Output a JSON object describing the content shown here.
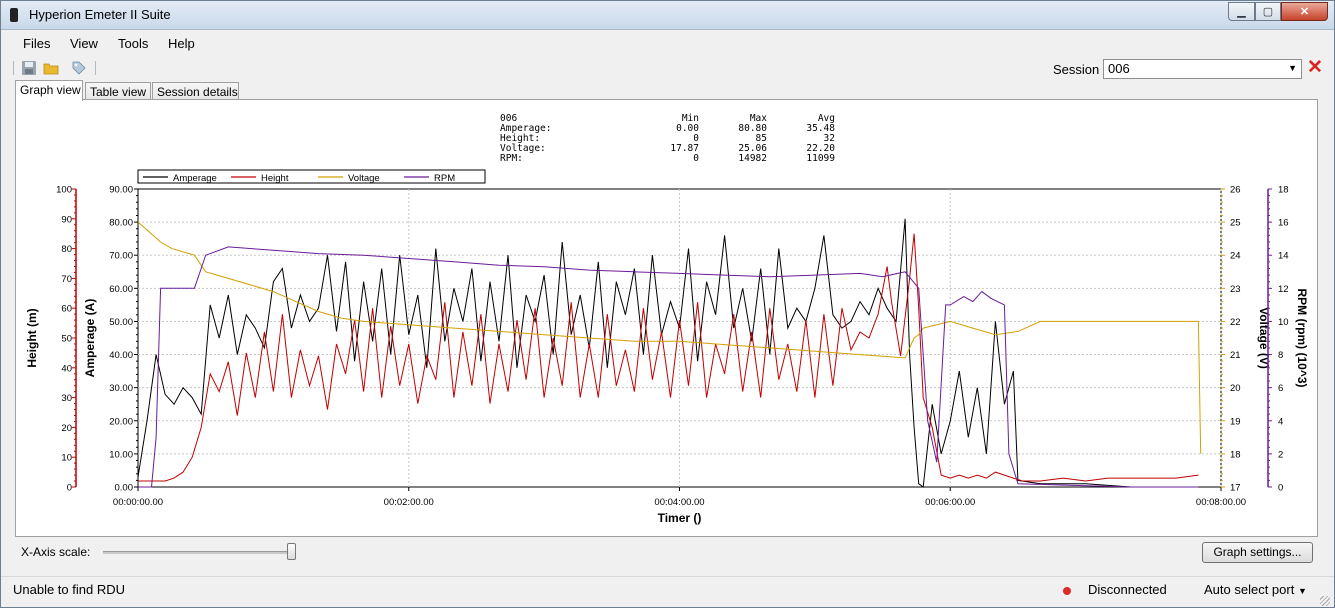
{
  "window": {
    "title": "Hyperion Emeter II Suite"
  },
  "menu": {
    "items": [
      "Files",
      "View",
      "Tools",
      "Help"
    ]
  },
  "toolbar": {
    "icons": [
      "save-icon",
      "open-folder-icon",
      "tag-icon"
    ],
    "session_label": "Session",
    "session_value": "006"
  },
  "tabs": [
    {
      "label": "Graph view",
      "active": true
    },
    {
      "label": "Table view"
    },
    {
      "label": "Session details"
    }
  ],
  "stats": {
    "session": "006",
    "headers": [
      "Min",
      "Max",
      "Avg"
    ],
    "rows": [
      {
        "name": "Amperage:",
        "min": "0.00",
        "max": "80.80",
        "avg": "35.48"
      },
      {
        "name": "Height:",
        "min": "0",
        "max": "85",
        "avg": "32"
      },
      {
        "name": "Voltage:",
        "min": "17.87",
        "max": "25.06",
        "avg": "22.20"
      },
      {
        "name": "RPM:",
        "min": "0",
        "max": "14982",
        "avg": "11099"
      }
    ]
  },
  "chart_data": {
    "type": "line",
    "xlabel": "Timer ()",
    "x_unit": "seconds",
    "xlim": [
      0,
      480
    ],
    "x_ticks": [
      "00:00:00.00",
      "00:02:00.00",
      "00:04:00.00",
      "00:06:00.00",
      "00:08:00.00"
    ],
    "legend": [
      "Amperage",
      "Height",
      "Voltage",
      "RPM"
    ],
    "legend_placement": "top-left",
    "grid": true,
    "axes": {
      "height": {
        "label": "Height (m)",
        "side": "left-outer",
        "range": [
          0,
          100
        ],
        "ticks": [
          "0",
          "10",
          "20",
          "30",
          "40",
          "50",
          "60",
          "70",
          "80",
          "90",
          "100"
        ],
        "color": "#c00000"
      },
      "amperage": {
        "label": "Amperage (A)",
        "side": "left-inner",
        "range": [
          0,
          90
        ],
        "ticks": [
          "0.00",
          "10.00",
          "20.00",
          "30.00",
          "40.00",
          "50.00",
          "60.00",
          "70.00",
          "80.00",
          "90.00"
        ],
        "color": "#000000"
      },
      "voltage": {
        "label": "Voltage (V)",
        "side": "right-inner",
        "range": [
          17,
          26
        ],
        "ticks": [
          "17",
          "18",
          "19",
          "20",
          "21",
          "22",
          "23",
          "24",
          "25",
          "26"
        ],
        "color": "#d4a000"
      },
      "rpm": {
        "label": "RPM (rpm) (10^3)",
        "side": "right-outer",
        "range": [
          0,
          18
        ],
        "ticks": [
          "0",
          "2",
          "4",
          "6",
          "8",
          "10",
          "12",
          "14",
          "16",
          "18"
        ],
        "color": "#6a1b9a"
      }
    },
    "series": [
      {
        "name": "Amperage",
        "axis": "amperage",
        "color": "#000000",
        "x": [
          0,
          4,
          8,
          12,
          16,
          20,
          24,
          28,
          32,
          36,
          40,
          44,
          48,
          52,
          56,
          60,
          64,
          68,
          72,
          76,
          80,
          84,
          88,
          92,
          96,
          100,
          104,
          108,
          112,
          116,
          120,
          124,
          128,
          132,
          136,
          140,
          144,
          148,
          152,
          156,
          160,
          164,
          168,
          172,
          176,
          180,
          184,
          188,
          192,
          196,
          200,
          204,
          208,
          212,
          216,
          220,
          224,
          228,
          232,
          236,
          240,
          244,
          248,
          252,
          256,
          260,
          264,
          268,
          272,
          276,
          280,
          284,
          288,
          292,
          296,
          300,
          304,
          308,
          312,
          316,
          320,
          324,
          328,
          332,
          336,
          340,
          342,
          344,
          346,
          348,
          352,
          356,
          360,
          364,
          368,
          372,
          376,
          380,
          384,
          388,
          390,
          400,
          420,
          440,
          460,
          470
        ],
        "y": [
          3,
          20,
          40,
          28,
          25,
          30,
          27,
          22,
          55,
          45,
          58,
          40,
          52,
          48,
          42,
          62,
          66,
          48,
          58,
          50,
          54,
          70,
          47,
          68,
          38,
          62,
          44,
          66,
          40,
          70,
          46,
          58,
          36,
          72,
          44,
          60,
          50,
          66,
          38,
          62,
          44,
          70,
          36,
          58,
          50,
          64,
          40,
          74,
          46,
          58,
          42,
          68,
          36,
          62,
          52,
          66,
          40,
          70,
          46,
          56,
          48,
          72,
          38,
          62,
          52,
          76,
          48,
          60,
          44,
          66,
          40,
          72,
          48,
          54,
          50,
          60,
          76,
          52,
          48,
          50,
          56,
          52,
          60,
          54,
          50,
          81,
          40,
          18,
          1,
          0,
          25,
          10,
          20,
          35,
          15,
          30,
          10,
          50,
          25,
          35,
          2,
          1,
          1,
          0,
          0,
          0
        ]
      },
      {
        "name": "Height",
        "axis": "height",
        "color": "#c00000",
        "x": [
          0,
          12,
          16,
          20,
          24,
          28,
          32,
          36,
          40,
          44,
          48,
          52,
          56,
          60,
          64,
          68,
          72,
          76,
          80,
          84,
          88,
          92,
          96,
          100,
          104,
          108,
          112,
          116,
          120,
          124,
          128,
          132,
          136,
          140,
          144,
          148,
          152,
          156,
          160,
          164,
          168,
          172,
          176,
          180,
          184,
          188,
          192,
          196,
          200,
          204,
          208,
          212,
          216,
          220,
          224,
          228,
          232,
          236,
          240,
          244,
          248,
          252,
          256,
          260,
          264,
          268,
          272,
          276,
          280,
          284,
          288,
          292,
          296,
          300,
          304,
          308,
          312,
          316,
          320,
          324,
          328,
          332,
          334,
          338,
          342,
          344,
          346,
          348,
          352,
          356,
          360,
          364,
          368,
          372,
          376,
          380,
          384,
          388,
          392,
          400,
          410,
          420,
          430,
          440,
          450,
          460,
          470
        ],
        "y": [
          2,
          2,
          3,
          5,
          10,
          20,
          38,
          32,
          42,
          24,
          45,
          30,
          52,
          32,
          58,
          30,
          46,
          34,
          44,
          26,
          48,
          38,
          56,
          32,
          60,
          30,
          54,
          34,
          48,
          28,
          44,
          36,
          62,
          30,
          52,
          34,
          58,
          28,
          48,
          32,
          56,
          36,
          60,
          30,
          50,
          34,
          62,
          30,
          48,
          30,
          58,
          34,
          46,
          32,
          60,
          36,
          52,
          30,
          56,
          34,
          62,
          30,
          48,
          38,
          58,
          32,
          52,
          30,
          60,
          36,
          48,
          32,
          56,
          30,
          58,
          34,
          60,
          46,
          52,
          50,
          58,
          74,
          62,
          44,
          70,
          85,
          60,
          30,
          20,
          4,
          3,
          4,
          3,
          4,
          3,
          5,
          4,
          3,
          2,
          2,
          3,
          2,
          3,
          3,
          3,
          3,
          4
        ]
      },
      {
        "name": "Voltage",
        "axis": "voltage",
        "color": "#d4a000",
        "x": [
          0,
          5,
          10,
          15,
          25,
          30,
          40,
          50,
          60,
          70,
          80,
          90,
          100,
          120,
          140,
          160,
          180,
          200,
          220,
          240,
          260,
          280,
          300,
          320,
          340,
          344,
          346,
          348,
          360,
          370,
          380,
          390,
          400,
          420,
          440,
          460,
          470,
          471
        ],
        "y": [
          25.0,
          24.7,
          24.4,
          24.2,
          24.0,
          23.5,
          23.3,
          23.1,
          22.9,
          22.6,
          22.3,
          22.1,
          22.0,
          21.9,
          21.8,
          21.7,
          21.6,
          21.5,
          21.4,
          21.4,
          21.3,
          21.2,
          21.1,
          21.0,
          20.9,
          21.5,
          21.6,
          21.8,
          22.0,
          21.8,
          21.6,
          21.7,
          22.0,
          22.0,
          22.0,
          22.0,
          22.0,
          18.0
        ]
      },
      {
        "name": "RPM",
        "axis": "rpm",
        "color": "#6a1b9a",
        "x": [
          0,
          6,
          8,
          10,
          20,
          25,
          30,
          40,
          60,
          80,
          100,
          120,
          140,
          160,
          180,
          200,
          220,
          240,
          260,
          280,
          300,
          320,
          330,
          340,
          346,
          350,
          354,
          358,
          360,
          366,
          370,
          374,
          378,
          384,
          386,
          390,
          440,
          470
        ],
        "y": [
          0,
          0,
          3,
          12,
          12,
          12,
          14,
          14.5,
          14.3,
          14.1,
          14.0,
          13.8,
          13.6,
          13.4,
          13.3,
          13.1,
          13.0,
          12.9,
          12.8,
          12.7,
          12.8,
          12.9,
          12.7,
          13.0,
          12.0,
          4.0,
          1.5,
          11.0,
          11.0,
          11.5,
          11.2,
          11.8,
          11.4,
          11.0,
          2.0,
          0.2,
          0,
          0
        ]
      }
    ]
  },
  "bottom": {
    "xscale_label": "X-Axis scale:",
    "xscale_value": 1.0,
    "graph_settings": "Graph settings..."
  },
  "status": {
    "message": "Unable to find RDU",
    "connection": "Disconnected",
    "port": "Auto select port"
  }
}
